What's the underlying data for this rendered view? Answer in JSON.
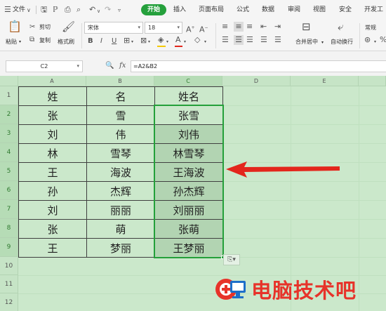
{
  "menubar": {
    "menu_label": "文件",
    "tabs": [
      "开始",
      "插入",
      "页面布局",
      "公式",
      "数据",
      "审阅",
      "视图",
      "安全",
      "开发工"
    ],
    "active_tab": "开始"
  },
  "ribbon": {
    "clipboard": {
      "paste": "粘贴",
      "cut": "剪切",
      "copy": "复制",
      "format_painter": "格式刷"
    },
    "font": {
      "name": "宋体",
      "size": "18"
    },
    "alignment": {
      "merge_center": "合并居中",
      "auto_wrap": "自动换行"
    },
    "number_format": "常规"
  },
  "formula_bar": {
    "name_box": "C2",
    "fx": "fx",
    "formula": "=A2&B2"
  },
  "sheet": {
    "columns": [
      "A",
      "B",
      "C",
      "D",
      "E"
    ],
    "rows": [
      "1",
      "2",
      "3",
      "4",
      "5",
      "6",
      "7",
      "8",
      "9",
      "10",
      "11",
      "12"
    ],
    "table": [
      [
        "姓",
        "名",
        "姓名"
      ],
      [
        "张",
        "雪",
        "张雪"
      ],
      [
        "刘",
        "伟",
        "刘伟"
      ],
      [
        "林",
        "雪琴",
        "林雪琴"
      ],
      [
        "王",
        "海波",
        "王海波"
      ],
      [
        "孙",
        "杰辉",
        "孙杰辉"
      ],
      [
        "刘",
        "丽丽",
        "刘丽丽"
      ],
      [
        "张",
        "萌",
        "张萌"
      ],
      [
        "王",
        "梦丽",
        "王梦丽"
      ]
    ]
  },
  "watermark": {
    "text": "电脑技术吧"
  },
  "colors": {
    "accent": "#25a03c",
    "sheet_bg": "#cbe8cb",
    "arrow": "#e3261c",
    "watermark": "#e7332a"
  }
}
